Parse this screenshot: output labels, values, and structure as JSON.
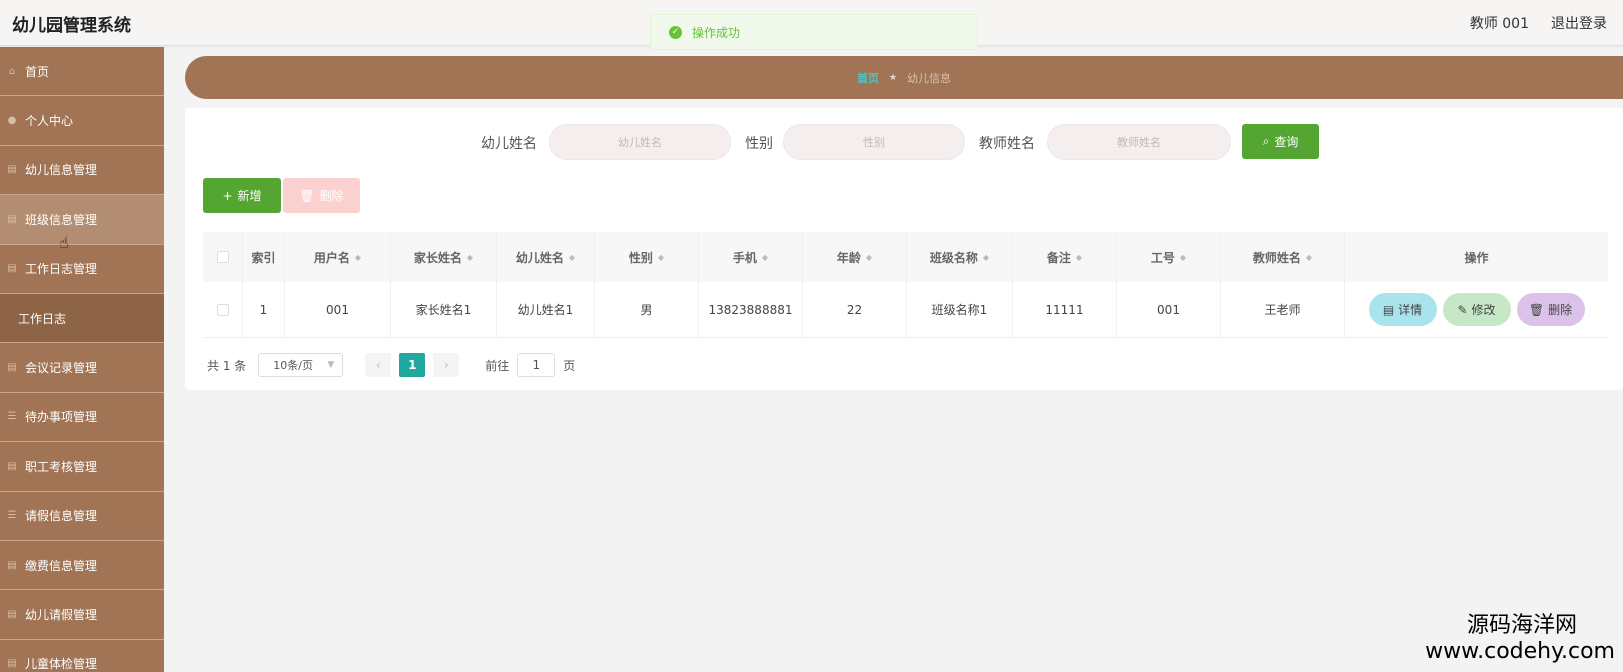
{
  "header": {
    "title": "幼儿园管理系统",
    "user": "教师 001",
    "logout": "退出登录"
  },
  "toast": {
    "message": "操作成功"
  },
  "sidebar": {
    "items": [
      {
        "label": "首页",
        "icon": "home-icon"
      },
      {
        "label": "个人中心",
        "icon": "user-icon"
      },
      {
        "label": "幼儿信息管理",
        "icon": "folder-icon"
      },
      {
        "label": "班级信息管理",
        "icon": "folder-icon"
      },
      {
        "label": "工作日志管理",
        "icon": "folder-icon"
      },
      {
        "label": "工作日志",
        "icon": ""
      },
      {
        "label": "会议记录管理",
        "icon": "folder-icon"
      },
      {
        "label": "待办事项管理",
        "icon": "list-icon"
      },
      {
        "label": "职工考核管理",
        "icon": "folder-icon"
      },
      {
        "label": "请假信息管理",
        "icon": "list-icon"
      },
      {
        "label": "缴费信息管理",
        "icon": "folder-icon"
      },
      {
        "label": "幼儿请假管理",
        "icon": "folder-icon"
      },
      {
        "label": "儿童体检管理",
        "icon": "folder-icon"
      }
    ]
  },
  "breadcrumb": {
    "home": "首页",
    "current": "幼儿信息"
  },
  "search": {
    "child_name_label": "幼儿姓名",
    "child_name_placeholder": "幼儿姓名",
    "gender_label": "性别",
    "gender_placeholder": "性别",
    "teacher_label": "教师姓名",
    "teacher_placeholder": "教师姓名",
    "query_button": "查询"
  },
  "toolbar": {
    "add_label": "新增",
    "delete_label": "删除"
  },
  "table": {
    "columns": [
      "索引",
      "用户名",
      "家长姓名",
      "幼儿姓名",
      "性别",
      "手机",
      "年龄",
      "班级名称",
      "备注",
      "工号",
      "教师姓名",
      "操作"
    ],
    "rows": [
      {
        "index": "1",
        "username": "001",
        "parent_name": "家长姓名1",
        "child_name": "幼儿姓名1",
        "gender": "男",
        "phone": "13823888881",
        "age": "22",
        "class_name": "班级名称1",
        "note": "11111",
        "work_id": "001",
        "teacher": "王老师",
        "actions": {
          "detail": "详情",
          "edit": "修改",
          "delete": "删除"
        }
      }
    ]
  },
  "pagination": {
    "total": "共 1 条",
    "page_size": "10条/页",
    "current_page": "1",
    "goto_label": "前往",
    "goto_value": "1",
    "page_unit": "页"
  },
  "watermark": {
    "line1": "源码海洋网",
    "line2": "www.codehy.com"
  },
  "colors": {
    "sidebar": "#a07454",
    "primary": "#55a532",
    "accent": "#20a8a0"
  }
}
